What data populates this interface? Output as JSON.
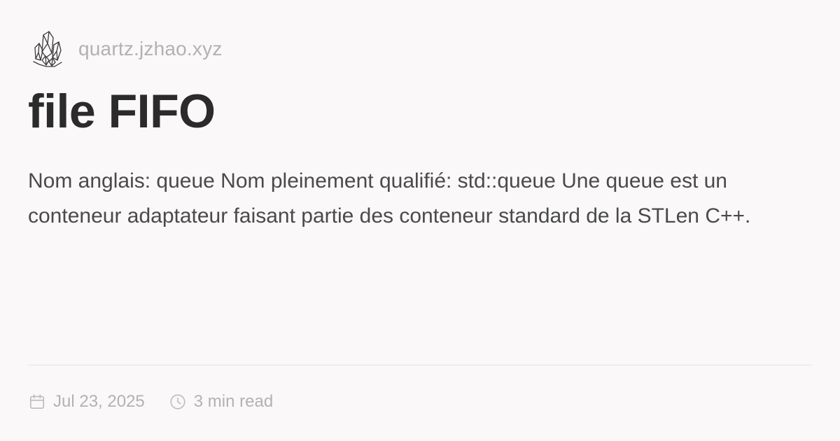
{
  "header": {
    "logo_icon": "crystal-cluster-icon",
    "site_name": "quartz.jzhao.xyz"
  },
  "page": {
    "title": "file FIFO",
    "description": "Nom anglais: queue Nom pleinement qualifié: std::queue Une queue est un conteneur adaptateur faisant partie des conteneur standard de la STLen C++."
  },
  "meta": {
    "date_icon": "calendar-icon",
    "date": "Jul 23, 2025",
    "reading_time_icon": "clock-icon",
    "reading_time": "3 min read"
  },
  "colors": {
    "background": "#faf8f8",
    "title": "#2b2b2b",
    "body_text": "#4a4a4a",
    "muted_text": "#b3b1b1",
    "divider": "#e6e4e4"
  }
}
